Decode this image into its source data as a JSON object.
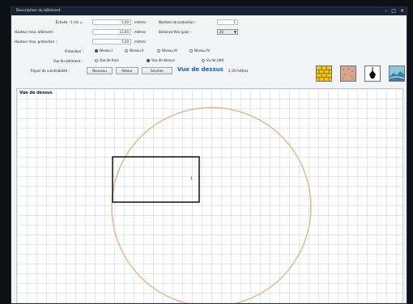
{
  "window": {
    "title": "Description du bâtiment",
    "controls": [
      "–",
      "□",
      "×"
    ]
  },
  "form": {
    "echelle_label": "Échelle : 1 cm =",
    "echelle_value": "5,00",
    "echelle_unit": "mètres",
    "hauteur_batiment_label": "Hauteur max. bâtiment :",
    "hauteur_batiment_value": "15,00",
    "hauteur_batiment_unit": "mètres",
    "hauteur_protection_label": "Hauteur max. protection :",
    "hauteur_protection_value": "5,00",
    "hauteur_protection_unit": "mètres",
    "nombre_protection_label": "Nombre de protection :",
    "nombre_protection_value": "1",
    "distance_label": "Distance fixe (pas) :",
    "distance_value": "20",
    "protection_label": "Protection :",
    "protection_options": [
      "Niveau I",
      "Niveau II",
      "Niveau III",
      "Niveau IV"
    ],
    "protection_selected": 0,
    "vue_label": "Vue du bâtiment :",
    "vue_options": [
      "Vue de face",
      "Vue de dessus",
      "Vu de côté"
    ],
    "vue_selected": 1,
    "rayon_label": "Rayon de vulnérabilité :",
    "buttons": {
      "nouveau": "Nouveau",
      "retour": "Retour",
      "generer": "Générer"
    },
    "view_title": "Vue de dessus",
    "view_subtitle": "2,19 mètres"
  },
  "tools": [
    "brick-wall-icon",
    "texture-icon",
    "lightning-rod-icon",
    "landscape-icon"
  ],
  "canvas": {
    "label": "Vue de dessus",
    "colors": {
      "circle": "#e2b98e",
      "building": "#111111",
      "grid": "#e3e6ea"
    },
    "marker_text": "!"
  }
}
